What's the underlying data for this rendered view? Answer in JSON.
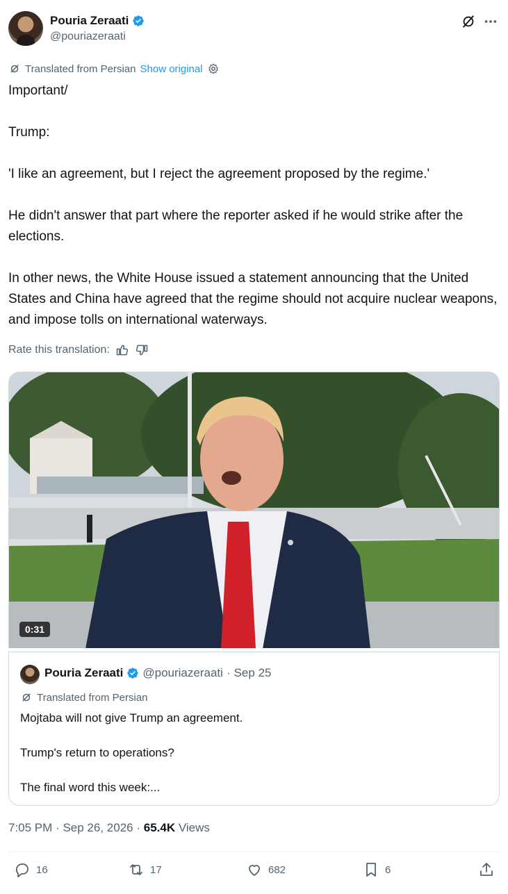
{
  "author": {
    "name": "Pouria Zeraati",
    "handle": "@pouriazeraati"
  },
  "translation": {
    "label": "Translated from Persian",
    "show_original": "Show original"
  },
  "tweet": {
    "text": "Important/\n\nTrump:\n\n'I like an agreement, but I reject the agreement proposed by the regime.'\n\nHe didn't answer that part where the reporter asked if he would strike after the elections.\n\nIn other news, the White House issued a statement announcing that the United States and China have agreed that the regime should not acquire nuclear weapons, and impose tolls on international waterways."
  },
  "rate_translation": "Rate this translation:",
  "video": {
    "duration": "0:31"
  },
  "quote": {
    "name": "Pouria Zeraati",
    "handle": "@pouriazeraati",
    "separator": "·",
    "date": "Sep 25",
    "translated_label": "Translated from Persian",
    "text": "Mojtaba will not give Trump an agreement.\n\nTrump's return to operations?\n\nThe final word this week:..."
  },
  "meta": {
    "time": "7:05 PM",
    "separator": "·",
    "date": "Sep 26, 2026",
    "views_count": "65.4K",
    "views_label": "Views"
  },
  "actions": {
    "replies": "16",
    "reposts": "17",
    "likes": "682",
    "bookmarks": "6"
  },
  "colors": {
    "accent": "#1d9bf0",
    "secondary_text": "#536471",
    "tie": "#d0202a",
    "suit": "#1f2a44"
  },
  "icons": [
    "verified-icon",
    "grok-icon",
    "more-icon",
    "translate-icon",
    "settings-icon",
    "thumbs-up-icon",
    "thumbs-down-icon",
    "reply-icon",
    "repost-icon",
    "like-icon",
    "bookmark-icon",
    "share-icon"
  ]
}
